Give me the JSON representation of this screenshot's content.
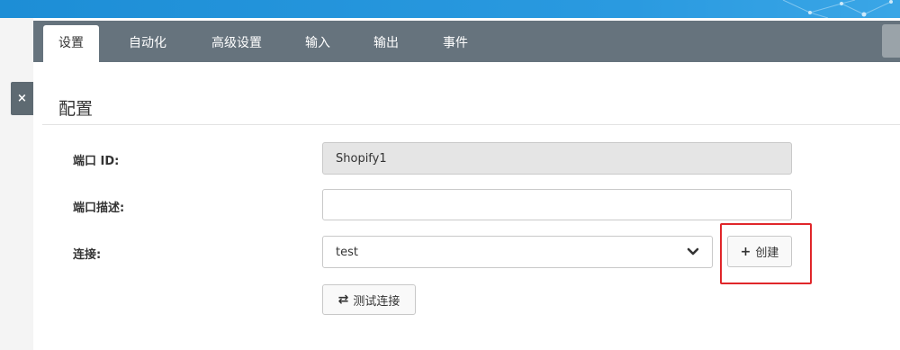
{
  "tabs": [
    {
      "label": "设置",
      "active": true
    },
    {
      "label": "自动化",
      "active": false
    },
    {
      "label": "高级设置",
      "active": false
    },
    {
      "label": "输入",
      "active": false
    },
    {
      "label": "输出",
      "active": false
    },
    {
      "label": "事件",
      "active": false
    }
  ],
  "sidebar": {
    "close_glyph": "×"
  },
  "section": {
    "title": "配置"
  },
  "form": {
    "port_id_label": "端口 ID:",
    "port_id_value": "Shopify1",
    "port_desc_label": "端口描述:",
    "port_desc_value": "",
    "connection_label": "连接:",
    "connection_value": "test"
  },
  "buttons": {
    "create_icon": "+",
    "create_label": "创建",
    "test_icon": "⇄",
    "test_label": "测试连接"
  },
  "colors": {
    "topbar": "#1d8ed6",
    "tabbar": "#66737d",
    "highlight": "#e0262a"
  }
}
